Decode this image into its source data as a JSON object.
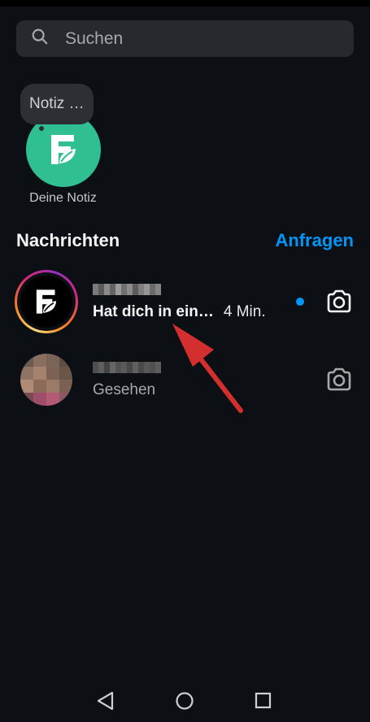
{
  "search": {
    "placeholder": "Suchen",
    "icon": "search-icon"
  },
  "note": {
    "bubble_text": "Notiz …",
    "label": "Deine Notiz",
    "avatar_color": "#2fbf90"
  },
  "section": {
    "title": "Nachrichten",
    "link": "Anfragen",
    "link_color": "#0095f6"
  },
  "conversations": [
    {
      "name": "",
      "message": "Hat dich in ein…",
      "time": "4 Min.",
      "unread": true,
      "story_ring": true,
      "action_icon": "camera-icon"
    },
    {
      "name": "",
      "message": "Gesehen",
      "time": "",
      "unread": false,
      "story_ring": false,
      "action_icon": "camera-icon"
    }
  ],
  "nav": {
    "buttons": [
      "back-icon",
      "home-icon",
      "recents-icon"
    ]
  },
  "colors": {
    "background": "#0c1014",
    "accent": "#0095f6",
    "annotation_arrow": "#d32f2f"
  }
}
